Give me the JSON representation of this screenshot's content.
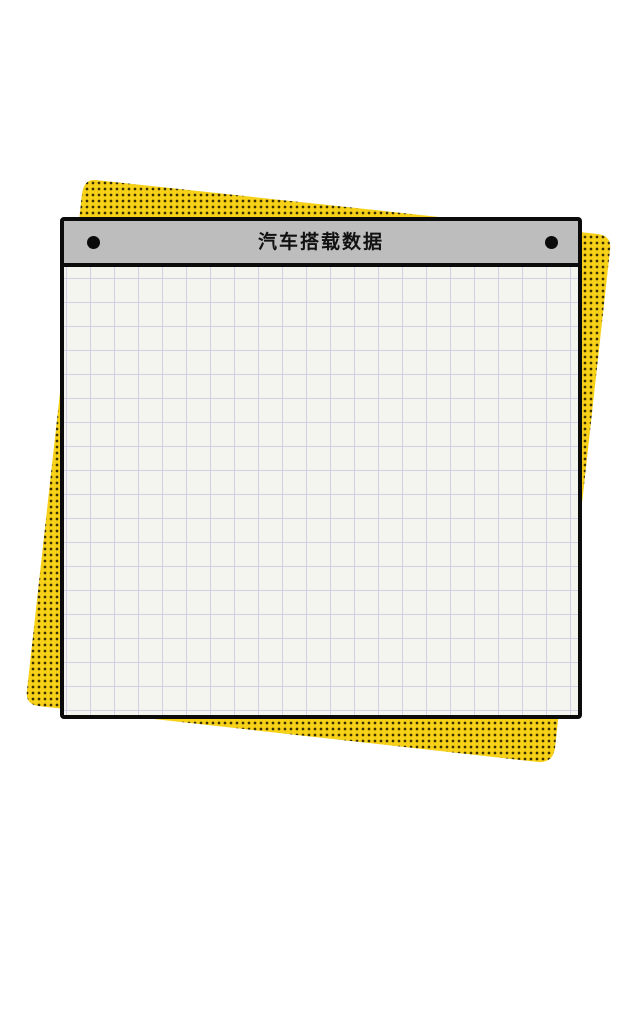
{
  "window": {
    "title": "汽车搭载数据"
  },
  "colors": {
    "accent_yellow": "#f7d117",
    "halftone_dot": "#3a3000",
    "titlebar_gray": "#bdbdbd",
    "paper": "#f4f5ef",
    "grid_line": "#d3d0e3",
    "frame": "#0b0b0b"
  }
}
